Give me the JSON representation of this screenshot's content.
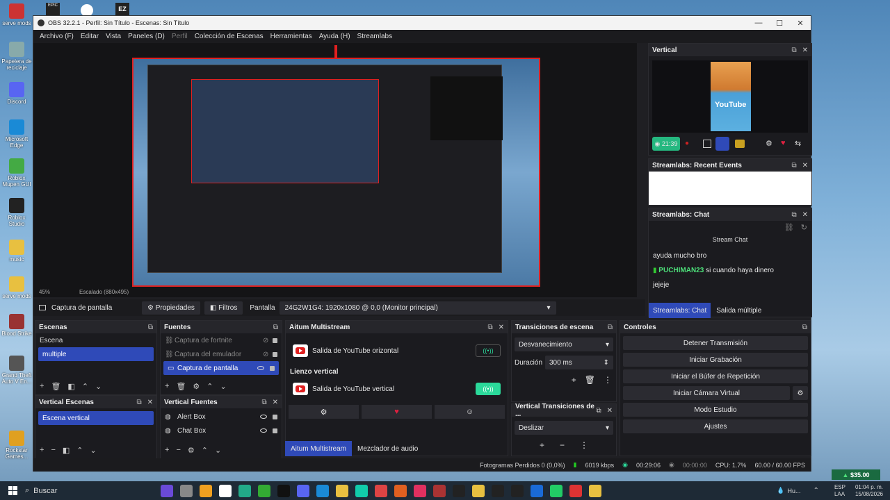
{
  "desktop": {
    "icons": [
      {
        "label": "serve mods",
        "color": "#c33"
      },
      {
        "label": "Papelera de reciclaje",
        "color": "#8aa"
      },
      {
        "label": "Discord",
        "color": "#5865f2"
      },
      {
        "label": "Microsoft Edge",
        "color": "#1a8ad6"
      },
      {
        "label": "Roblox Mupen GUI",
        "color": "#4a4"
      },
      {
        "label": "Roblox Studio",
        "color": "#222"
      },
      {
        "label": "music",
        "color": "#e8c040"
      },
      {
        "label": "serve mods",
        "color": "#e8c040"
      },
      {
        "label": "Blood Strike",
        "color": "#933"
      },
      {
        "label": "Grand Theft Auto V En...",
        "color": "#555"
      },
      {
        "label": "Rockstar Games...",
        "color": "#e0a020"
      }
    ],
    "top_icons": [
      "EPIC",
      "EZ"
    ]
  },
  "window": {
    "title": "OBS 32.2.1 - Perfil: Sin Título - Escenas: Sin Título",
    "controls": [
      "—",
      "☐",
      "✕"
    ]
  },
  "menu": {
    "items": [
      "Archivo (F)",
      "Editar",
      "Vista",
      "Paneles (D)",
      "Perfil",
      "Colección de Escenas",
      "Herramientas",
      "Ayuda (H)",
      "Streamlabs"
    ]
  },
  "preview": {
    "zoom": "45%",
    "scale": "Escalado (880x495)"
  },
  "source_bar": {
    "source": "Captura de pantalla",
    "props": "Propiedades",
    "filters": "Filtros",
    "display_label": "Pantalla",
    "display_value": "24G2W1G4: 1920x1080 @ 0,0 (Monitor principal)"
  },
  "vertical": {
    "title": "Vertical",
    "timer": "21:39",
    "thumb_text": "YouTube"
  },
  "recent_events": {
    "title": "Streamlabs: Recent Events"
  },
  "chat": {
    "title": "Streamlabs: Chat",
    "header": "Stream Chat",
    "messages": [
      {
        "user": "",
        "text": "ayuda mucho bro"
      },
      {
        "user": "PUCHIMAN23",
        "text": "si cuando haya dinero"
      },
      {
        "user": "",
        "text": "jejeje"
      }
    ],
    "tabs": [
      "Streamlabs: Chat",
      "Salida múltiple"
    ]
  },
  "scenes": {
    "title": "Escenas",
    "items": [
      "Escena",
      "multiple"
    ]
  },
  "sources": {
    "title": "Fuentes",
    "items": [
      "Captura de fortnite",
      "Captura del emulador",
      "Captura de pantalla"
    ]
  },
  "vscenes": {
    "title": "Vertical Escenas",
    "items": [
      "Escena vertical"
    ]
  },
  "vsources": {
    "title": "Vertical Fuentes",
    "items": [
      "Alert Box",
      "Chat Box"
    ]
  },
  "multistream": {
    "title": "Aitum Multistream",
    "out1": "Salida de YouTube orizontal",
    "section": "Lienzo vertical",
    "out2": "Salida de YouTube vertical",
    "tabs": [
      "Aitum Multistream",
      "Mezclador de audio"
    ]
  },
  "transitions": {
    "title": "Transiciones de escena",
    "type": "Desvanecimiento",
    "duration_label": "Duración",
    "duration": "300 ms"
  },
  "vtransitions": {
    "title": "Vertical Transiciones de ...",
    "type": "Deslizar"
  },
  "controls": {
    "title": "Controles",
    "buttons": [
      "Detener Transmisión",
      "Iniciar Grabación",
      "Iniciar el Búfer de Repetición",
      "Iniciar Cámara Virtual",
      "Modo Estudio",
      "Ajustes"
    ]
  },
  "status": {
    "frames": "Fotogramas Perdidos 0 (0,0%)",
    "kbps": "6019 kbps",
    "stream_time": "00:29:06",
    "rec_time": "00:00:00",
    "cpu": "CPU: 1.7%",
    "fps": "60.00 / 60.00 FPS"
  },
  "donation": "$35.00",
  "taskbar": {
    "search": "Buscar",
    "lang1": "ESP",
    "lang2": "LAA",
    "time": "01:04 p. m.",
    "date": "15/08/2026",
    "weather": "Hu..."
  },
  "colors": {
    "accent": "#2f4ab8",
    "live_green": "#2bd99a"
  }
}
